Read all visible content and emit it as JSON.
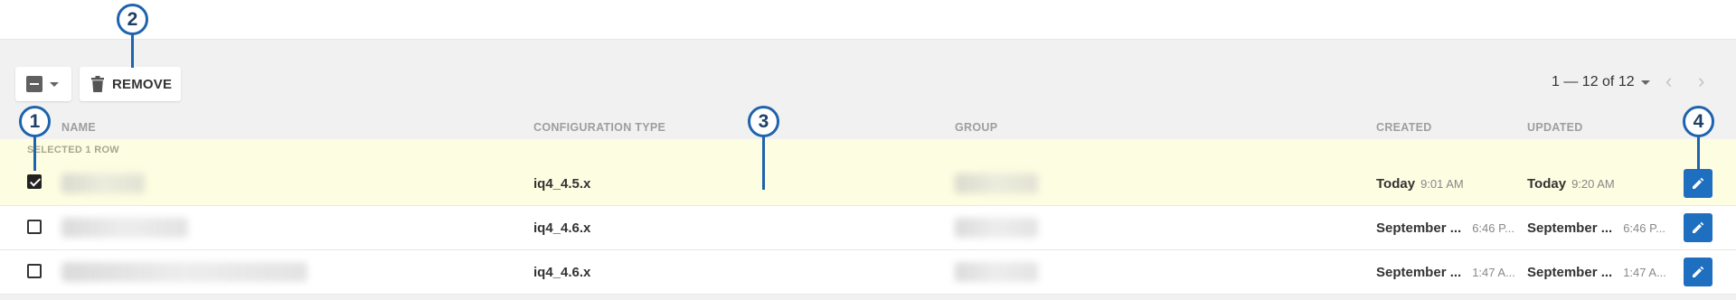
{
  "toolbar": {
    "remove_label": "REMOVE"
  },
  "pagination": {
    "range": "1 — 12 of 12",
    "prev": "‹",
    "next": "›"
  },
  "columns": {
    "name": "NAME",
    "config_type": "CONFIGURATION TYPE",
    "group": "GROUP",
    "created": "CREATED",
    "updated": "UPDATED"
  },
  "selection_banner": "SELECTED 1 ROW",
  "rows": [
    {
      "checked": true,
      "config_type": "iq4_4.5.x",
      "created_day": "Today",
      "created_time": "9:01 AM",
      "updated_day": "Today",
      "updated_time": "9:20 AM"
    },
    {
      "checked": false,
      "config_type": "iq4_4.6.x",
      "created_day": "September ...",
      "created_time": "6:46 P...",
      "updated_day": "September ...",
      "updated_time": "6:46 P..."
    },
    {
      "checked": false,
      "config_type": "iq4_4.6.x",
      "created_day": "September ...",
      "created_time": "1:47 A...",
      "updated_day": "September ...",
      "updated_time": "1:47 A..."
    }
  ],
  "callouts": [
    "1",
    "2",
    "3",
    "4"
  ],
  "colors": {
    "accent": "#1e6fc0",
    "callout": "#1e63ad",
    "selected_row": "#fdfde2"
  }
}
